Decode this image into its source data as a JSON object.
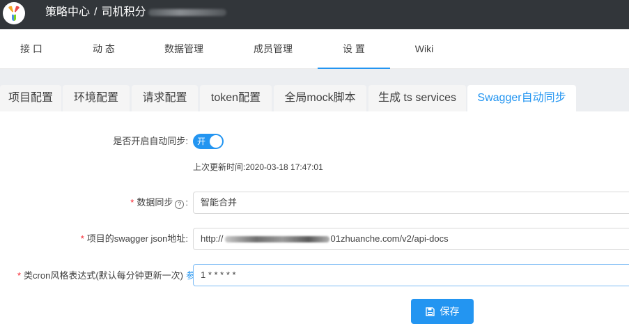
{
  "header": {
    "breadcrumb_group": "策略中心",
    "breadcrumb_separator": "/",
    "breadcrumb_project": "司机积分"
  },
  "nav": {
    "items": [
      {
        "label": "接 口"
      },
      {
        "label": "动 态"
      },
      {
        "label": "数据管理"
      },
      {
        "label": "成员管理"
      },
      {
        "label": "设 置"
      },
      {
        "label": "Wiki"
      }
    ],
    "active_index": 4
  },
  "settings_tabs": {
    "items": [
      {
        "label": "项目配置"
      },
      {
        "label": "环境配置"
      },
      {
        "label": "请求配置"
      },
      {
        "label": "token配置"
      },
      {
        "label": "全局mock脚本"
      },
      {
        "label": "生成 ts services"
      },
      {
        "label": "Swagger自动同步"
      }
    ],
    "active_index": 6
  },
  "form": {
    "auto_sync_label": "是否开启自动同步:",
    "auto_sync_switch_text": "开",
    "auto_sync_on": true,
    "last_updated_text": "上次更新时间:2020-03-18 17:47:01",
    "data_sync_label": "数据同步",
    "data_sync_help": "?",
    "data_sync_colon": ":",
    "data_sync_value": "智能合并",
    "swagger_url_label": "项目的swagger json地址:",
    "swagger_url_prefix": "http://",
    "swagger_url_suffix": "01zhuanche.com/v2/api-docs",
    "cron_label": "类cron风格表达式(默认每分钟更新一次)",
    "cron_ref_text": "参",
    "cron_value": "1 * * * * *",
    "save_label": "保存"
  },
  "colors": {
    "accent": "#2395f1",
    "topbar": "#32363a",
    "required": "#f5222d"
  }
}
